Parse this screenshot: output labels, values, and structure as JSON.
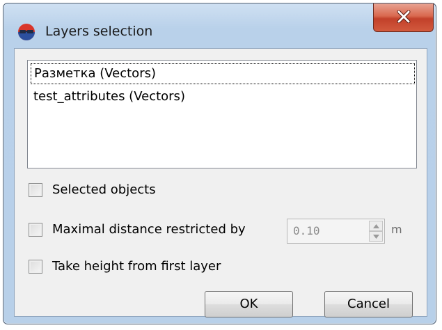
{
  "window": {
    "title": "Layers selection"
  },
  "layers": {
    "items": [
      {
        "label": "Разметка (Vectors)",
        "focused": true
      },
      {
        "label": "test_attributes (Vectors)",
        "focused": false
      }
    ]
  },
  "options": {
    "selected_objects": {
      "label": "Selected objects",
      "checked": false
    },
    "max_distance": {
      "label": "Maximal distance restricted by",
      "checked": false,
      "value": "0.10",
      "unit": "m"
    },
    "take_height": {
      "label": "Take height from first layer",
      "checked": false
    }
  },
  "buttons": {
    "ok": "OK",
    "cancel": "Cancel"
  },
  "icons": {
    "app": "stereo-glasses-icon",
    "close": "close-icon"
  },
  "colors": {
    "title_bar": "#b9d1ea",
    "close_button": "#c94a33",
    "client_bg": "#f0f0f0"
  }
}
